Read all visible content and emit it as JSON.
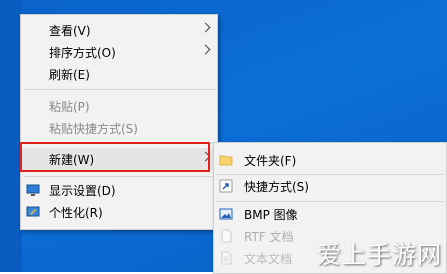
{
  "context_menu": {
    "items": [
      {
        "label": "查看(V)"
      },
      {
        "label": "排序方式(O)"
      },
      {
        "label": "刷新(E)"
      },
      {
        "label": "粘贴(P)"
      },
      {
        "label": "粘贴快捷方式(S)"
      },
      {
        "label": "新建(W)"
      },
      {
        "label": "显示设置(D)"
      },
      {
        "label": "个性化(R)"
      }
    ]
  },
  "new_submenu": {
    "items": [
      {
        "label": "文件夹(F)"
      },
      {
        "label": "快捷方式(S)"
      },
      {
        "label": "BMP 图像"
      },
      {
        "label": "RTF 文档"
      },
      {
        "label": "文本文档"
      }
    ]
  },
  "watermark": {
    "text": "爱上手游网"
  },
  "colors": {
    "highlight_box": "#e2231a",
    "desktop": "#0a63c9"
  }
}
